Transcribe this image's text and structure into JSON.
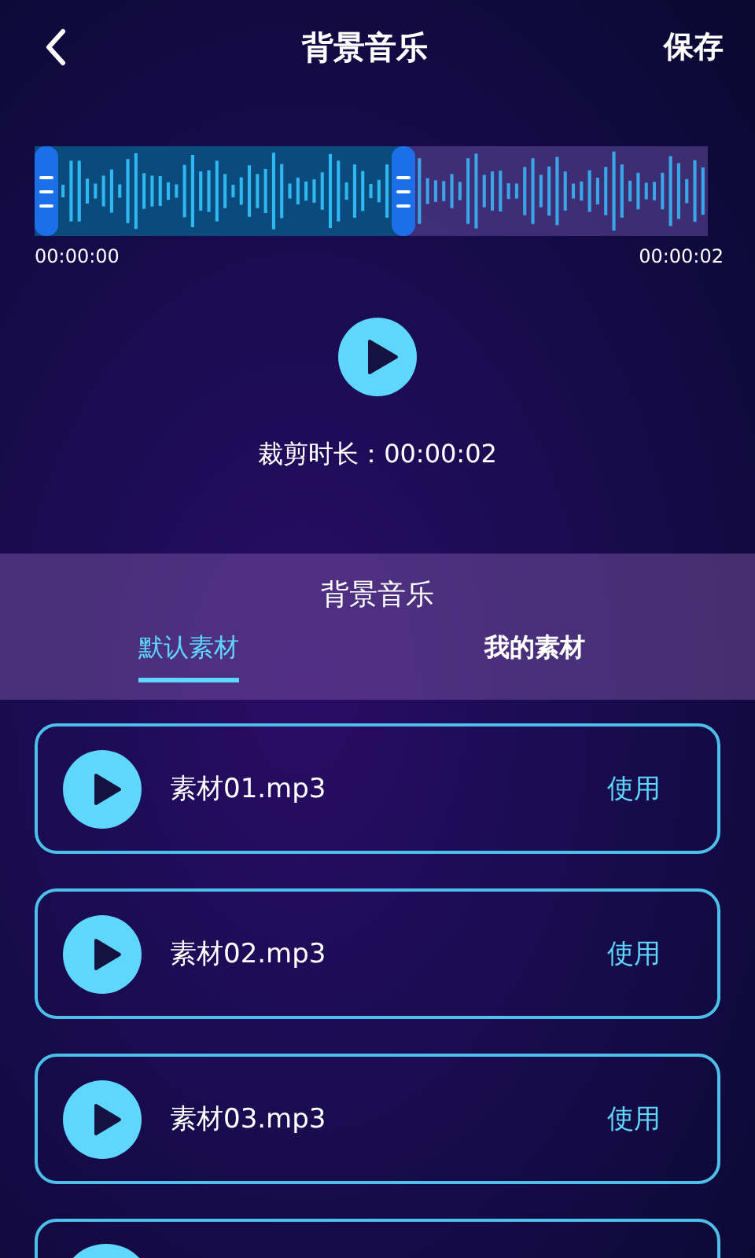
{
  "header": {
    "title": "背景音乐",
    "action": "保存"
  },
  "trimmer": {
    "level": 0.55,
    "start_time": "00:00:00",
    "end_time": "00:00:02"
  },
  "crop_duration": "裁剪时长：00:00:02",
  "panel": {
    "title": "背景音乐",
    "tabs": [
      {
        "label": "默认素材",
        "selected": true
      },
      {
        "label": "我的素材",
        "selected": false
      }
    ]
  },
  "tracks": [
    {
      "name": "素材01.mp3",
      "action": "使用"
    },
    {
      "name": "素材02.mp3",
      "action": "使用"
    },
    {
      "name": "素材03.mp3",
      "action": "使用"
    }
  ]
}
